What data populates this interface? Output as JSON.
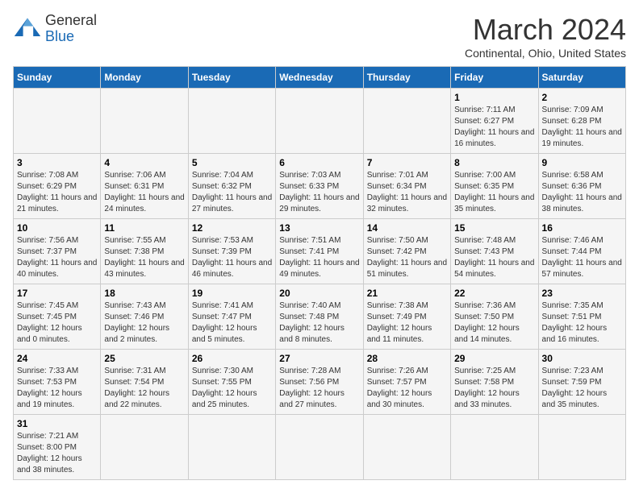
{
  "logo": {
    "text_general": "General",
    "text_blue": "Blue"
  },
  "header": {
    "title": "March 2024",
    "subtitle": "Continental, Ohio, United States"
  },
  "days_of_week": [
    "Sunday",
    "Monday",
    "Tuesday",
    "Wednesday",
    "Thursday",
    "Friday",
    "Saturday"
  ],
  "weeks": [
    [
      {
        "day": "",
        "info": ""
      },
      {
        "day": "",
        "info": ""
      },
      {
        "day": "",
        "info": ""
      },
      {
        "day": "",
        "info": ""
      },
      {
        "day": "",
        "info": ""
      },
      {
        "day": "1",
        "info": "Sunrise: 7:11 AM\nSunset: 6:27 PM\nDaylight: 11 hours and 16 minutes."
      },
      {
        "day": "2",
        "info": "Sunrise: 7:09 AM\nSunset: 6:28 PM\nDaylight: 11 hours and 19 minutes."
      }
    ],
    [
      {
        "day": "3",
        "info": "Sunrise: 7:08 AM\nSunset: 6:29 PM\nDaylight: 11 hours and 21 minutes."
      },
      {
        "day": "4",
        "info": "Sunrise: 7:06 AM\nSunset: 6:31 PM\nDaylight: 11 hours and 24 minutes."
      },
      {
        "day": "5",
        "info": "Sunrise: 7:04 AM\nSunset: 6:32 PM\nDaylight: 11 hours and 27 minutes."
      },
      {
        "day": "6",
        "info": "Sunrise: 7:03 AM\nSunset: 6:33 PM\nDaylight: 11 hours and 29 minutes."
      },
      {
        "day": "7",
        "info": "Sunrise: 7:01 AM\nSunset: 6:34 PM\nDaylight: 11 hours and 32 minutes."
      },
      {
        "day": "8",
        "info": "Sunrise: 7:00 AM\nSunset: 6:35 PM\nDaylight: 11 hours and 35 minutes."
      },
      {
        "day": "9",
        "info": "Sunrise: 6:58 AM\nSunset: 6:36 PM\nDaylight: 11 hours and 38 minutes."
      }
    ],
    [
      {
        "day": "10",
        "info": "Sunrise: 7:56 AM\nSunset: 7:37 PM\nDaylight: 11 hours and 40 minutes."
      },
      {
        "day": "11",
        "info": "Sunrise: 7:55 AM\nSunset: 7:38 PM\nDaylight: 11 hours and 43 minutes."
      },
      {
        "day": "12",
        "info": "Sunrise: 7:53 AM\nSunset: 7:39 PM\nDaylight: 11 hours and 46 minutes."
      },
      {
        "day": "13",
        "info": "Sunrise: 7:51 AM\nSunset: 7:41 PM\nDaylight: 11 hours and 49 minutes."
      },
      {
        "day": "14",
        "info": "Sunrise: 7:50 AM\nSunset: 7:42 PM\nDaylight: 11 hours and 51 minutes."
      },
      {
        "day": "15",
        "info": "Sunrise: 7:48 AM\nSunset: 7:43 PM\nDaylight: 11 hours and 54 minutes."
      },
      {
        "day": "16",
        "info": "Sunrise: 7:46 AM\nSunset: 7:44 PM\nDaylight: 11 hours and 57 minutes."
      }
    ],
    [
      {
        "day": "17",
        "info": "Sunrise: 7:45 AM\nSunset: 7:45 PM\nDaylight: 12 hours and 0 minutes."
      },
      {
        "day": "18",
        "info": "Sunrise: 7:43 AM\nSunset: 7:46 PM\nDaylight: 12 hours and 2 minutes."
      },
      {
        "day": "19",
        "info": "Sunrise: 7:41 AM\nSunset: 7:47 PM\nDaylight: 12 hours and 5 minutes."
      },
      {
        "day": "20",
        "info": "Sunrise: 7:40 AM\nSunset: 7:48 PM\nDaylight: 12 hours and 8 minutes."
      },
      {
        "day": "21",
        "info": "Sunrise: 7:38 AM\nSunset: 7:49 PM\nDaylight: 12 hours and 11 minutes."
      },
      {
        "day": "22",
        "info": "Sunrise: 7:36 AM\nSunset: 7:50 PM\nDaylight: 12 hours and 14 minutes."
      },
      {
        "day": "23",
        "info": "Sunrise: 7:35 AM\nSunset: 7:51 PM\nDaylight: 12 hours and 16 minutes."
      }
    ],
    [
      {
        "day": "24",
        "info": "Sunrise: 7:33 AM\nSunset: 7:53 PM\nDaylight: 12 hours and 19 minutes."
      },
      {
        "day": "25",
        "info": "Sunrise: 7:31 AM\nSunset: 7:54 PM\nDaylight: 12 hours and 22 minutes."
      },
      {
        "day": "26",
        "info": "Sunrise: 7:30 AM\nSunset: 7:55 PM\nDaylight: 12 hours and 25 minutes."
      },
      {
        "day": "27",
        "info": "Sunrise: 7:28 AM\nSunset: 7:56 PM\nDaylight: 12 hours and 27 minutes."
      },
      {
        "day": "28",
        "info": "Sunrise: 7:26 AM\nSunset: 7:57 PM\nDaylight: 12 hours and 30 minutes."
      },
      {
        "day": "29",
        "info": "Sunrise: 7:25 AM\nSunset: 7:58 PM\nDaylight: 12 hours and 33 minutes."
      },
      {
        "day": "30",
        "info": "Sunrise: 7:23 AM\nSunset: 7:59 PM\nDaylight: 12 hours and 35 minutes."
      }
    ],
    [
      {
        "day": "31",
        "info": "Sunrise: 7:21 AM\nSunset: 8:00 PM\nDaylight: 12 hours and 38 minutes."
      },
      {
        "day": "",
        "info": ""
      },
      {
        "day": "",
        "info": ""
      },
      {
        "day": "",
        "info": ""
      },
      {
        "day": "",
        "info": ""
      },
      {
        "day": "",
        "info": ""
      },
      {
        "day": "",
        "info": ""
      }
    ]
  ]
}
